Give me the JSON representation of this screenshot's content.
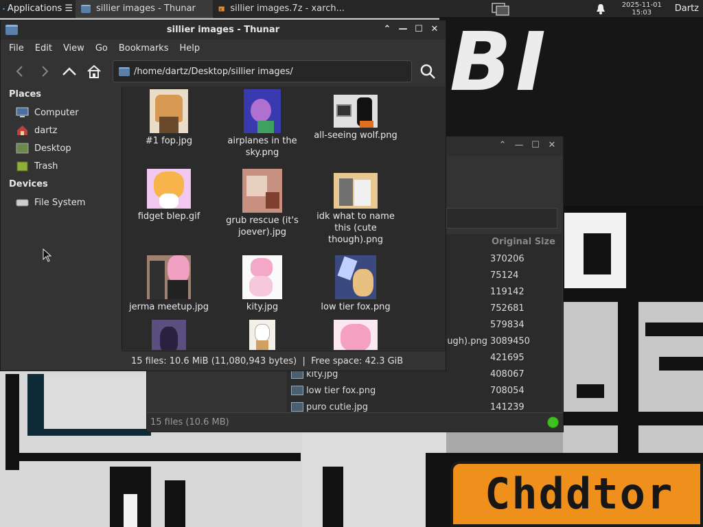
{
  "panel": {
    "apps_label": "Applications",
    "apps_suffix": "☰",
    "tasks": [
      {
        "label": "sillier images - Thunar",
        "icon": "folder-icon",
        "active": true
      },
      {
        "label": "sillier images.7z - xarch...",
        "icon": "xarchiver-icon",
        "active": false
      }
    ],
    "clock_date": "2025-11-01",
    "clock_time": "15:03",
    "user": "Dartz"
  },
  "thunar": {
    "title": "sillier images - Thunar",
    "menu": [
      "File",
      "Edit",
      "View",
      "Go",
      "Bookmarks",
      "Help"
    ],
    "location": "/home/dartz/Desktop/sillier images/",
    "sidebar": {
      "places_header": "Places",
      "places": [
        {
          "label": "Computer",
          "icon": "computer-icon"
        },
        {
          "label": "dartz",
          "icon": "home-folder-icon"
        },
        {
          "label": "Desktop",
          "icon": "desktop-icon"
        },
        {
          "label": "Trash",
          "icon": "trash-icon"
        }
      ],
      "devices_header": "Devices",
      "devices": [
        {
          "label": "File System",
          "icon": "drive-icon"
        }
      ]
    },
    "files": [
      {
        "name": "#1 fop.jpg"
      },
      {
        "name": "airplanes in the sky.png"
      },
      {
        "name": "all-seeing wolf.png"
      },
      {
        "name": "fidget blep.gif"
      },
      {
        "name": "grub rescue (it's joever).jpg"
      },
      {
        "name": "idk what to name this (cute though).png"
      },
      {
        "name": "jerma meetup.jpg"
      },
      {
        "name": "kity.jpg"
      },
      {
        "name": "low tier fox.png"
      },
      {
        "name": ""
      },
      {
        "name": ""
      },
      {
        "name": ""
      }
    ],
    "status": "15 files: 10.6 MiB (11,080,943 bytes)  |  Free space: 42.3 GiB"
  },
  "xarchiver": {
    "column_header": "Original Size",
    "rows": [
      {
        "name": "",
        "size": "370206"
      },
      {
        "name": "",
        "size": "75124"
      },
      {
        "name": "",
        "size": "119142"
      },
      {
        "name": "",
        "size": "752681"
      },
      {
        "name": "",
        "size": "579834"
      },
      {
        "name": "ugh).png",
        "size": "3089450"
      },
      {
        "name": "",
        "size": "421695"
      },
      {
        "name": "kity.jpg",
        "size": "408067"
      },
      {
        "name": "low tier fox.png",
        "size": "708054"
      },
      {
        "name": "puro cutie.jpg",
        "size": "141239"
      }
    ],
    "status": "15 files  (10.6 MB)"
  },
  "wallpaper": {
    "cap_text": "BI",
    "sign_text": "Chddtor",
    "accent_orange": "#f0901c"
  }
}
